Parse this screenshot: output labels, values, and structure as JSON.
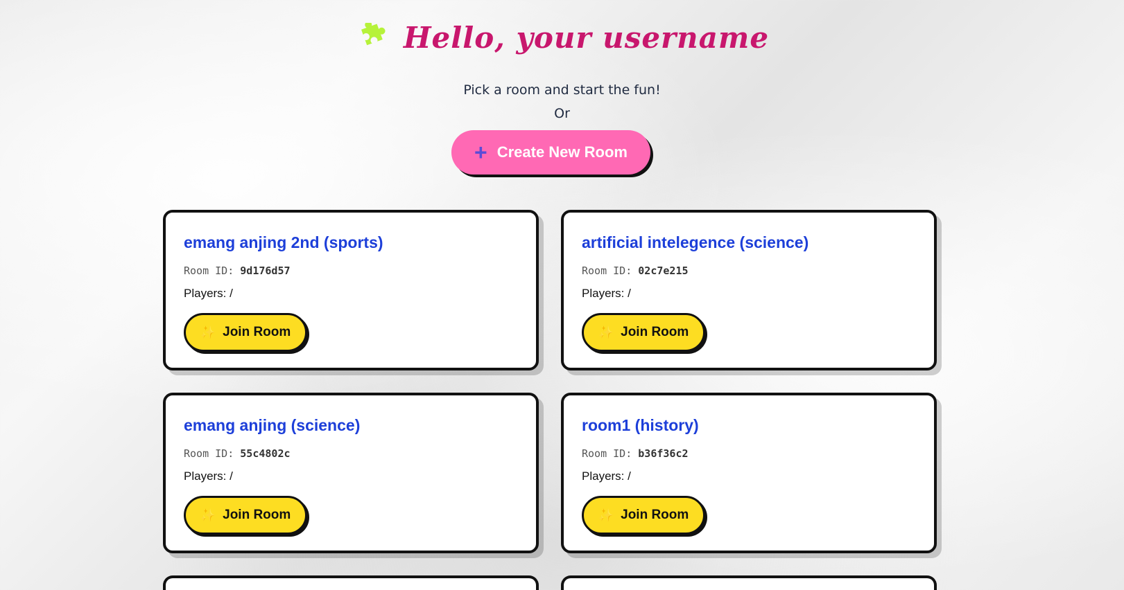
{
  "header": {
    "greeting": "Hello, your username",
    "subtitle": "Pick a room and start the fun!",
    "or_text": "Or"
  },
  "create_button": {
    "label": "Create New Room"
  },
  "rooms": [
    {
      "title": "emang anjing 2nd (sports)",
      "id_label": "Room ID:",
      "id": "9d176d57",
      "players": "Players: /",
      "join_label": "Join Room"
    },
    {
      "title": "artificial intelegence (science)",
      "id_label": "Room ID:",
      "id": "02c7e215",
      "players": "Players: /",
      "join_label": "Join Room"
    },
    {
      "title": "emang anjing (science)",
      "id_label": "Room ID:",
      "id": "55c4802c",
      "players": "Players: /",
      "join_label": "Join Room"
    },
    {
      "title": "room1 (history)",
      "id_label": "Room ID:",
      "id": "b36f36c2",
      "players": "Players: /",
      "join_label": "Join Room"
    }
  ],
  "colors": {
    "greeting": "#c8176d",
    "create_button": "#ff69b4",
    "room_title": "#1d3fd9",
    "join_button": "#fddd22",
    "puzzle_icon": "#b6f23a"
  },
  "icons": [
    "puzzle-icon",
    "plus-icon",
    "sparkle-icon"
  ]
}
